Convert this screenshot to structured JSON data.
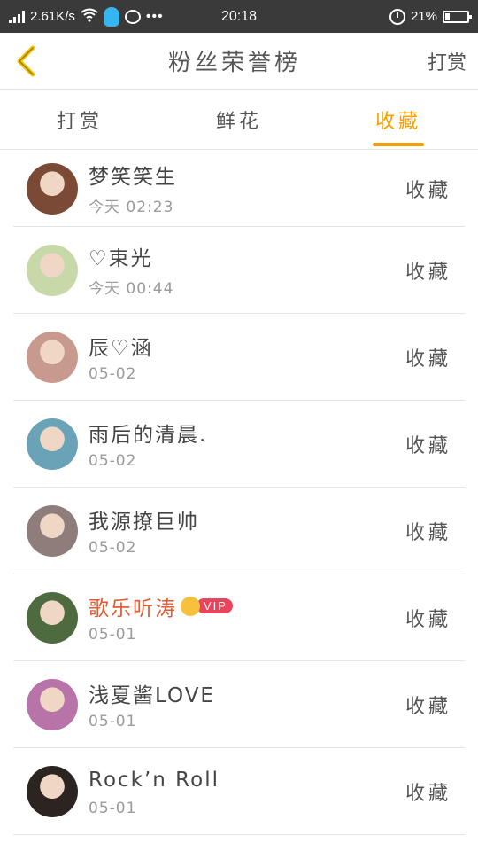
{
  "status_bar": {
    "speed": "2.61K/s",
    "time": "20:18",
    "battery": "21%",
    "battery_level": 0.21
  },
  "header": {
    "title": "粉丝荣誉榜",
    "right_action": "打赏"
  },
  "tabs": [
    {
      "label": "打赏",
      "active": false
    },
    {
      "label": "鲜花",
      "active": false
    },
    {
      "label": "收藏",
      "active": true
    }
  ],
  "list": [
    {
      "name": "梦笑笑生",
      "time": "今天 02:23",
      "action": "收藏",
      "vip": false,
      "avatar_color": "#7a4a36"
    },
    {
      "name": "♡束光",
      "time": "今天 00:44",
      "action": "收藏",
      "vip": false,
      "avatar_color": "#c7d9a8"
    },
    {
      "name": "辰♡涵",
      "time": "05-02",
      "action": "收藏",
      "vip": false,
      "avatar_color": "#c89a8e"
    },
    {
      "name": "雨后的清晨.",
      "time": "05-02",
      "action": "收藏",
      "vip": false,
      "avatar_color": "#6aa3b8"
    },
    {
      "name": "我源撩巨帅",
      "time": "05-02",
      "action": "收藏",
      "vip": false,
      "avatar_color": "#8e7d7a"
    },
    {
      "name": "歌乐听涛",
      "time": "05-01",
      "action": "收藏",
      "vip": true,
      "vip_label": "VIP",
      "avatar_color": "#4e6b3f"
    },
    {
      "name": "浅夏酱LOVE",
      "time": "05-01",
      "action": "收藏",
      "vip": false,
      "avatar_color": "#b874a8"
    },
    {
      "name": "Rock’n Roll",
      "time": "05-01",
      "action": "收藏",
      "vip": false,
      "avatar_color": "#2b2420"
    }
  ]
}
